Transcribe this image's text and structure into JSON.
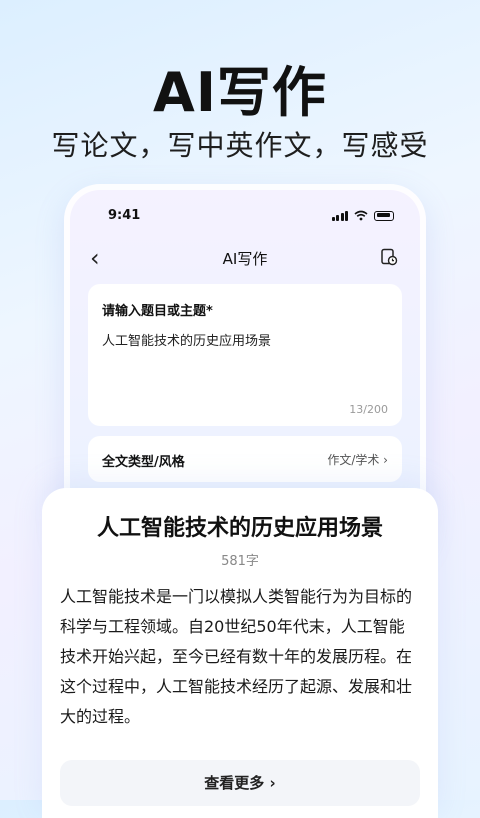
{
  "hero": {
    "title": "AI写作",
    "subtitle": "写论文，写中英作文，写感受"
  },
  "phone": {
    "status": {
      "time": "9:41"
    },
    "nav": {
      "back_icon": "chevron-left-icon",
      "title": "AI写作",
      "history_icon": "history-doc-icon"
    },
    "input": {
      "label": "请输入题目或主题*",
      "value": "人工智能技术的历史应用场景",
      "count": "13/200"
    },
    "type": {
      "label": "全文类型/风格",
      "value": "作文/学术 ›"
    }
  },
  "article": {
    "title": "人工智能技术的历史应用场景",
    "word_count": "581字",
    "body": "人工智能技术是一门以模拟人类智能行为为目标的科学与工程领域。自20世纪50年代末，人工智能技术开始兴起，至今已经有数十年的发展历程。在这个过程中，人工智能技术经历了起源、发展和壮大的过程。",
    "more": "查看更多 ›"
  }
}
